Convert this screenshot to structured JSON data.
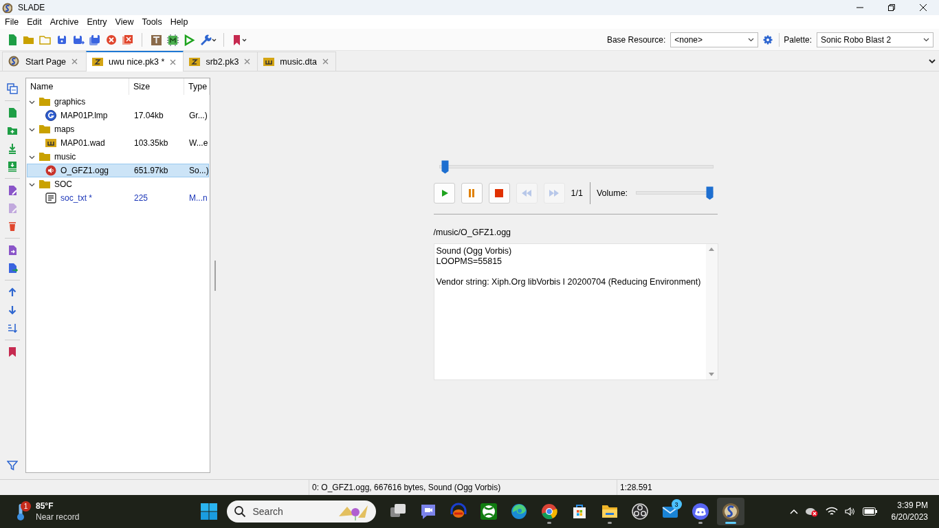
{
  "window": {
    "title": "SLADE"
  },
  "menu": [
    "File",
    "Edit",
    "Archive",
    "Entry",
    "View",
    "Tools",
    "Help"
  ],
  "resource_bar": {
    "base_label": "Base Resource:",
    "base_value": "<none>",
    "palette_label": "Palette:",
    "palette_value": "Sonic Robo Blast 2"
  },
  "tabs": [
    {
      "label": "Start Page",
      "kind": "start",
      "selected": false
    },
    {
      "label": "uwu nice.pk3 *",
      "kind": "zip",
      "selected": true
    },
    {
      "label": "srb2.pk3",
      "kind": "zip",
      "selected": false
    },
    {
      "label": "music.dta",
      "kind": "wad",
      "selected": false
    }
  ],
  "tree": {
    "columns": [
      "Name",
      "Size",
      "Type"
    ],
    "items": [
      {
        "name": "graphics",
        "kind": "folder",
        "expanded": true,
        "selected": false,
        "children": [
          {
            "name": "MAP01P.lmp",
            "size": "17.04kb",
            "type": "Gr...)",
            "kind": "graphic",
            "selected": false,
            "modified": false
          }
        ]
      },
      {
        "name": "maps",
        "kind": "folder",
        "expanded": true,
        "selected": false,
        "children": [
          {
            "name": "MAP01.wad",
            "size": "103.35kb",
            "type": "W...e",
            "kind": "wad",
            "selected": false,
            "modified": false
          }
        ]
      },
      {
        "name": "music",
        "kind": "folder",
        "expanded": true,
        "selected": false,
        "children": [
          {
            "name": "O_GFZ1.ogg",
            "size": "651.97kb",
            "type": "So...)",
            "kind": "audio",
            "selected": true,
            "modified": false
          }
        ]
      },
      {
        "name": "SOC",
        "kind": "folder",
        "expanded": true,
        "selected": false,
        "children": [
          {
            "name": "soc_txt *",
            "size": "225",
            "type": "M...n",
            "kind": "text",
            "selected": false,
            "modified": true
          }
        ]
      }
    ]
  },
  "player": {
    "seek": {
      "level": 0.01
    },
    "buttons": [
      {
        "kind": "play",
        "disabled": false
      },
      {
        "kind": "pause",
        "disabled": false
      },
      {
        "kind": "stop",
        "disabled": false
      },
      {
        "kind": "prev",
        "disabled": true
      },
      {
        "kind": "next",
        "disabled": true
      }
    ],
    "track": "1/1",
    "volume_label": "Volume:",
    "volume": {
      "level": 1.0
    }
  },
  "entry_path": "/music/O_GFZ1.ogg",
  "info": [
    {
      "lines": [
        "Sound (Ogg Vorbis)",
        "LOOPMS=55815"
      ]
    },
    {
      "lines": [
        "Vendor string: Xiph.Org libVorbis I 20200704 (Reducing Environment)"
      ]
    }
  ],
  "status_bar": [
    "0: O_GFZ1.ogg, 667616 bytes, Sound (Ogg Vorbis)",
    "1:28.591"
  ],
  "taskbar": {
    "weather": {
      "temperature": "85°F",
      "note": "Near record",
      "badge": "1"
    },
    "search": {
      "placeholder": "Search"
    },
    "apps": [
      {
        "kind": "taskview",
        "running": false,
        "active": false
      },
      {
        "kind": "teams",
        "running": false,
        "active": false
      },
      {
        "kind": "headphones",
        "running": false,
        "active": false
      },
      {
        "kind": "xbox",
        "running": false,
        "active": false
      },
      {
        "kind": "edge",
        "running": false,
        "active": false
      },
      {
        "kind": "chrome",
        "running": true,
        "active": false
      },
      {
        "kind": "store",
        "running": false,
        "active": false
      },
      {
        "kind": "explorer",
        "running": true,
        "active": false
      },
      {
        "kind": "obs",
        "running": false,
        "active": false
      },
      {
        "kind": "mail",
        "running": false,
        "active": false,
        "badge": "3"
      },
      {
        "kind": "discord",
        "running": true,
        "active": false
      },
      {
        "kind": "slade",
        "running": true,
        "active": true
      }
    ],
    "clock": {
      "time": "3:39 PM",
      "date": "6/20/2023"
    }
  }
}
